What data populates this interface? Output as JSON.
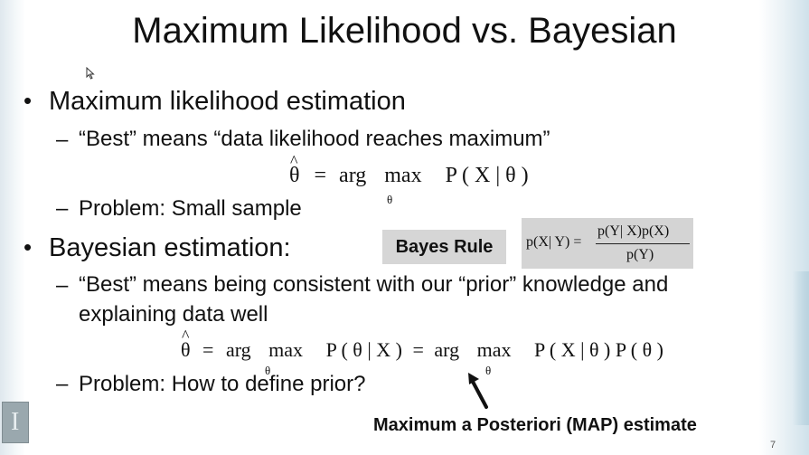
{
  "slide": {
    "title": "Maximum Likelihood vs. Bayesian",
    "page_number": "7"
  },
  "bullets": {
    "mle": {
      "heading": "Maximum likelihood estimation",
      "sub1": "“Best” means “data likelihood reaches maximum”",
      "equation": {
        "lhs": "θ",
        "eq": "=",
        "arg": "arg",
        "max": "max",
        "rhs": "P ( X  | θ )",
        "subscript": "θ"
      },
      "sub2": "Problem: Small sample"
    },
    "bayes": {
      "heading": "Bayesian estimation:",
      "sub1_line1": "“Best” means being consistent with our “prior” knowledge and",
      "sub1_line2": "explaining data well",
      "equation": {
        "lhs": "θ",
        "eq1": "=",
        "arg1": "arg",
        "max1": "max",
        "mid": "P ( θ | X )",
        "eq2": "=",
        "arg2": "arg",
        "max2": "max",
        "rhs": "P ( X  | θ ) P ( θ )",
        "subscript1": "θ",
        "subscript2": "θ"
      },
      "sub2": "Problem: How to define prior?"
    }
  },
  "bayes_rule": {
    "label": "Bayes Rule",
    "lhs": "p(X| Y) =",
    "numerator": "p(Y| X)p(X)",
    "denominator": "p(Y)"
  },
  "map_label": "Maximum a Posteriori (MAP) estimate",
  "colors": {
    "text": "#111111",
    "box_gray": "#d6d6d6",
    "edge_tint": "#cfe1ea"
  }
}
